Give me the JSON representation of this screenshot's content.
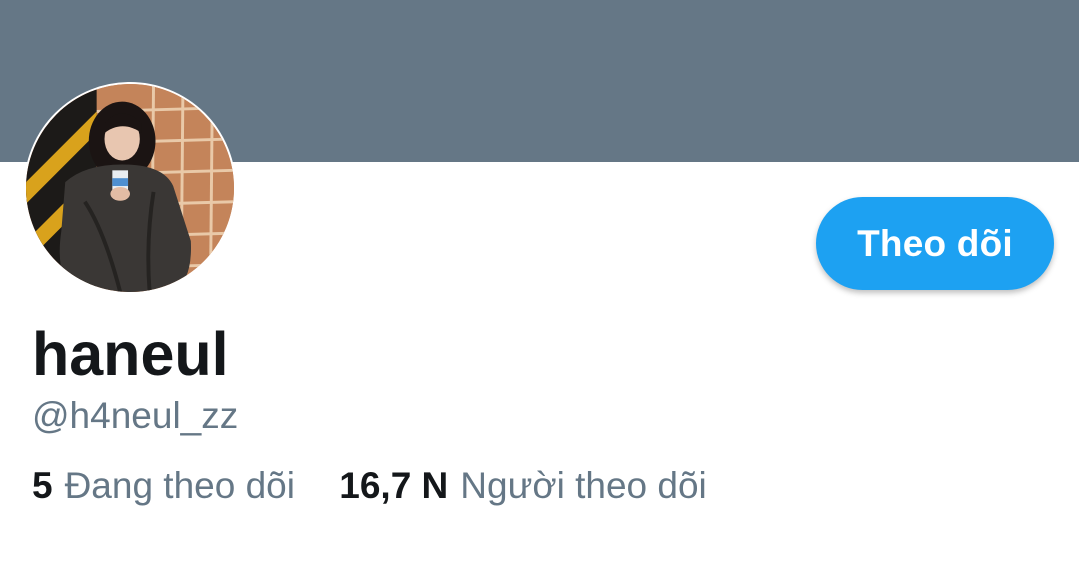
{
  "banner": {
    "color": "#657786"
  },
  "profile": {
    "display_name": "haneul",
    "handle": "@h4neul_zz",
    "avatar_icon": "profile-photo"
  },
  "follow_button": {
    "label": "Theo dõi",
    "color": "#1da1f2"
  },
  "stats": {
    "following_count": "5",
    "following_label": "Đang theo dõi",
    "followers_count": "16,7 N",
    "followers_label": "Người theo dõi"
  }
}
